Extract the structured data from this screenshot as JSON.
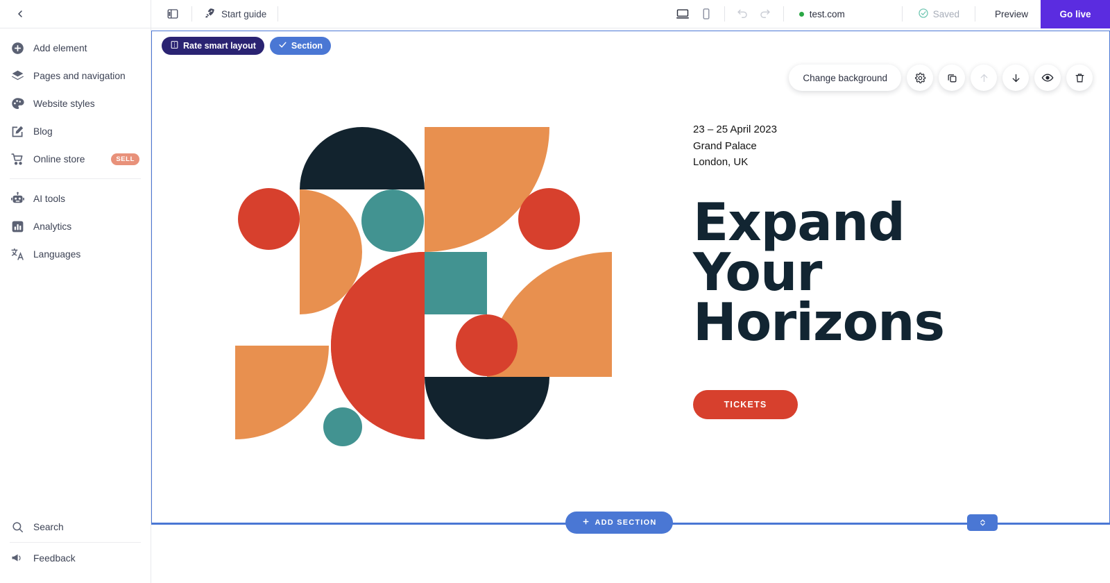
{
  "topbar": {
    "back_icon": "chevron-left-icon",
    "panel_toggle_icon": "side-panel-icon",
    "start_guide": {
      "label": "Start guide",
      "icon": "rocket-icon"
    },
    "desktop_icon": "desktop-icon",
    "mobile_icon": "mobile-icon",
    "undo_icon": "undo-icon",
    "redo_icon": "redo-icon",
    "site_url": "test.com",
    "status_dot_color": "#2aa745",
    "saved_label": "Saved",
    "saved_icon": "check-circle-icon",
    "preview_label": "Preview",
    "go_live_label": "Go live",
    "go_live_color": "#5b2ce0"
  },
  "sidebar": {
    "group1": [
      {
        "label": "Add element",
        "icon": "plus-circle-icon"
      },
      {
        "label": "Pages and navigation",
        "icon": "layers-icon"
      },
      {
        "label": "Website styles",
        "icon": "palette-icon"
      },
      {
        "label": "Blog",
        "icon": "edit-square-icon"
      },
      {
        "label": "Online store",
        "icon": "shopping-cart-icon",
        "badge": "SELL"
      }
    ],
    "group2": [
      {
        "label": "AI tools",
        "icon": "robot-icon"
      },
      {
        "label": "Analytics",
        "icon": "bar-chart-icon"
      },
      {
        "label": "Languages",
        "icon": "translate-icon"
      }
    ],
    "bottom": [
      {
        "label": "Search",
        "icon": "search-icon"
      },
      {
        "label": "Feedback",
        "icon": "megaphone-icon"
      }
    ]
  },
  "canvas": {
    "badges": [
      {
        "label": "Rate smart layout",
        "icon": "layout-rate-icon",
        "color": "#2a2372"
      },
      {
        "label": "Section",
        "icon": "check-icon",
        "color": "#4a77d4"
      }
    ],
    "section_toolbar": {
      "change_background_label": "Change background",
      "buttons": [
        {
          "name": "settings",
          "icon": "gear-icon",
          "disabled": false
        },
        {
          "name": "duplicate",
          "icon": "copy-icon",
          "disabled": false
        },
        {
          "name": "move-up",
          "icon": "arrow-up-icon",
          "disabled": true
        },
        {
          "name": "move-down",
          "icon": "arrow-down-icon",
          "disabled": false
        },
        {
          "name": "hide",
          "icon": "eye-icon",
          "disabled": false
        },
        {
          "name": "delete",
          "icon": "trash-icon",
          "disabled": false
        }
      ]
    },
    "add_section_label": "ADD SECTION",
    "add_section_icon": "plus-icon",
    "resize_icon": "chevron-up-down-icon"
  },
  "hero": {
    "event_date": "23 – 25 April 2023",
    "venue": "Grand Palace",
    "city": "London, UK",
    "headline_line1": "Expand",
    "headline_line2": "Your",
    "headline_line3": "Horizons",
    "cta_label": "TICKETS",
    "cta_color": "#d7402d",
    "palette": {
      "orange": "#e8904f",
      "red": "#d7402d",
      "teal": "#429391",
      "navy": "#12232e",
      "heading": "#122532"
    }
  }
}
